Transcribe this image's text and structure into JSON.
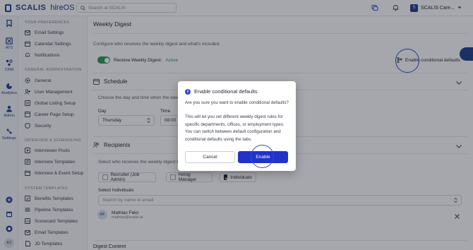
{
  "app": {
    "brand": "SCALIS",
    "product": "hireOS"
  },
  "search": {
    "placeholder": "Search at SCALIS"
  },
  "org": {
    "name": "SCALIS Care...",
    "badge": "S"
  },
  "rail": [
    {
      "label": "",
      "icon": "bookmark-icon"
    },
    {
      "label": "ATS",
      "icon": "ats-icon"
    },
    {
      "label": "CRM",
      "icon": "crm-icon"
    },
    {
      "label": "Analytics",
      "icon": "analytics-icon"
    },
    {
      "label": "Admin",
      "icon": "admin-icon"
    },
    {
      "label": "Settings",
      "icon": "settings-icon"
    }
  ],
  "user": {
    "initials": "KZ"
  },
  "sidebar": {
    "sections": [
      {
        "title": "YOUR PREFERENCES",
        "items": [
          "Email Settings",
          "Calendar Settings",
          "Notifications"
        ]
      },
      {
        "title": "GENERAL ADMINISTRATION",
        "items": [
          "General",
          "User Management",
          "Global Listing Setup",
          "Career Page Setup",
          "Security"
        ]
      },
      {
        "title": "INTERVIEW & SCHEDULING",
        "items": [
          "Interviewer Pools",
          "Interview Templates",
          "Interview & Event Setup"
        ]
      },
      {
        "title": "SYSTEM TEMPLATES",
        "items": [
          "Benefits Templates",
          "Pipeline Templates",
          "Scorecard Templates",
          "Email Templates",
          "JD Templates"
        ]
      }
    ]
  },
  "main": {
    "title": "Weekly Digest",
    "description": "Configure who receives the weekly digest and what's included.",
    "toggle_label": "Receive Weekly Digest:",
    "toggle_status": "Active",
    "enable_conditional_link": "Enable conditional defaults",
    "schedule": {
      "title": "Schedule",
      "subtitle": "Choose the day and time when the weekl",
      "day_label": "Day",
      "day_value": "Thursday",
      "time_label": "Time",
      "time_value": "08:00"
    },
    "recipients": {
      "title": "Recipients",
      "subtitle": "Select who receives the weekly digest by",
      "options": [
        {
          "label": "Recruiter (Job Admin)",
          "checked": false
        },
        {
          "label": "Hiring Manager",
          "checked": false
        },
        {
          "label": "Individuals",
          "checked": true
        }
      ],
      "select_individuals_label": "Select Individuals",
      "select_placeholder": "Search by name or email",
      "person": {
        "initials": "MF",
        "name": "Mathias Falci",
        "email": "mathias@scalis.ai"
      }
    },
    "digest_content_title": "Digest Content"
  },
  "modal": {
    "title": "Enable conditional defaults",
    "question": "Are you sure you want to enable conditional defaults?",
    "body": "This will let you set different weekly digest rules for specific departments, offices, or employment types. You can switch between default configuration and conditional defaults using the tabs.",
    "cancel_label": "Cancel",
    "enable_label": "Enable"
  },
  "colors": {
    "brand": "#1f3f8f",
    "primary_button": "#2233c8",
    "active_green": "#2e9b55",
    "overlay": "rgba(20,24,36,0.38)"
  }
}
